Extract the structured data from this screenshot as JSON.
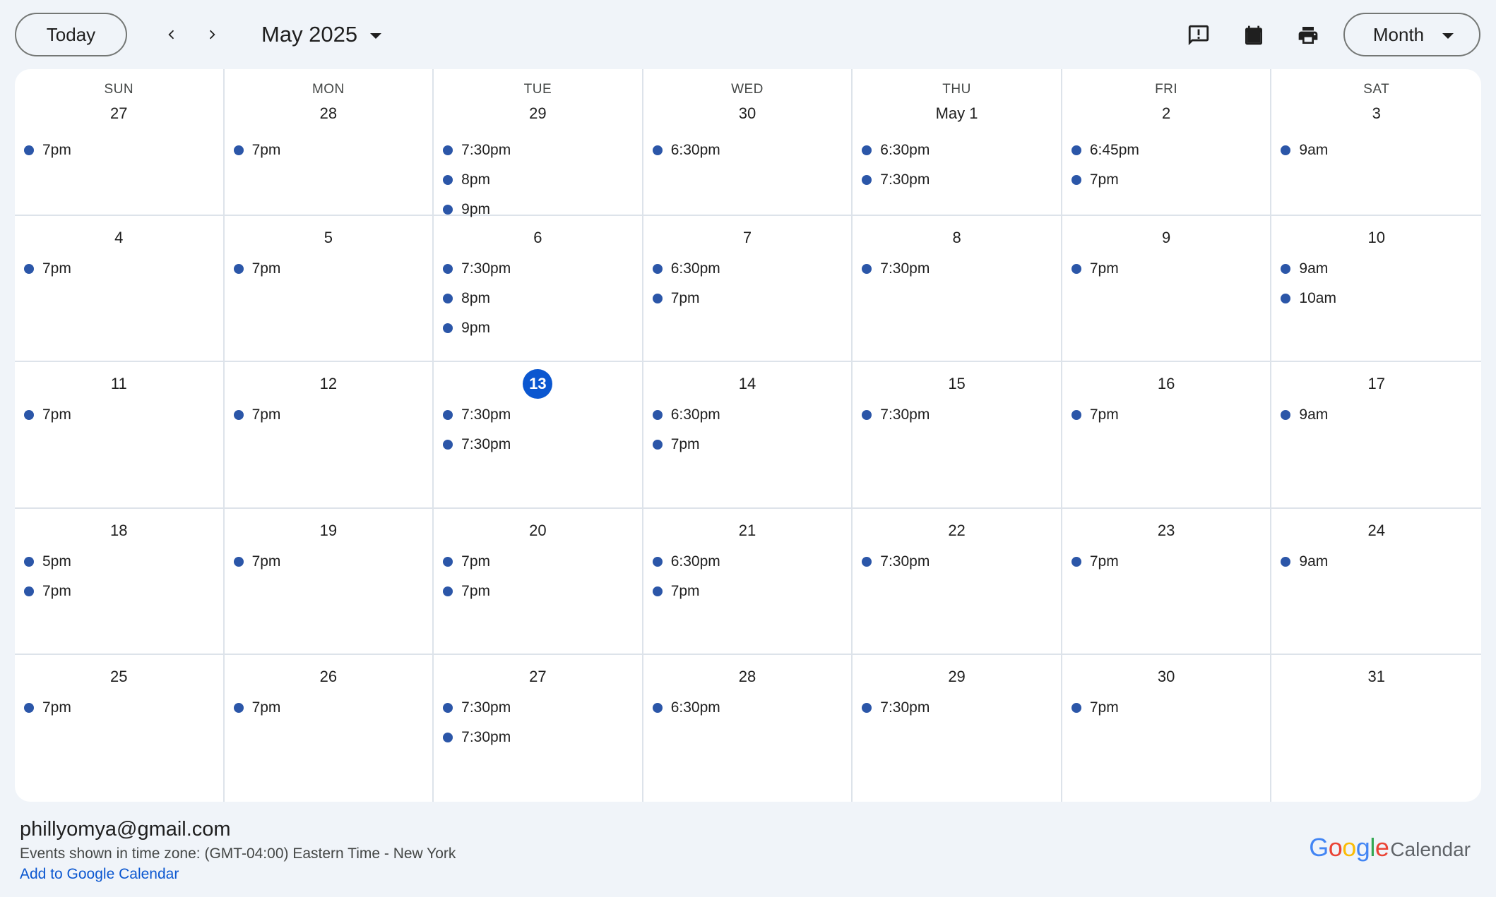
{
  "toolbar": {
    "today_label": "Today",
    "prev_icon": "chevron-left-icon",
    "next_icon": "chevron-right-icon",
    "month_title": "May 2025",
    "feedback_icon": "feedback-icon",
    "calendar_icon": "calendar-icon",
    "print_icon": "print-icon",
    "view_label": "Month"
  },
  "colors": {
    "background": "#f0f4f9",
    "event_dot": "#2b56a8",
    "today_badge": "#0b57d0",
    "link": "#0b57d0"
  },
  "weekdays": [
    "SUN",
    "MON",
    "TUE",
    "WED",
    "THU",
    "FRI",
    "SAT"
  ],
  "today_index": 16,
  "days": [
    {
      "date": "27",
      "events": [
        "7pm"
      ]
    },
    {
      "date": "28",
      "events": [
        "7pm"
      ]
    },
    {
      "date": "29",
      "events": [
        "7:30pm",
        "8pm",
        "9pm"
      ]
    },
    {
      "date": "30",
      "events": [
        "6:30pm"
      ]
    },
    {
      "date": "May 1",
      "events": [
        "6:30pm",
        "7:30pm"
      ]
    },
    {
      "date": "2",
      "events": [
        "6:45pm",
        "7pm"
      ]
    },
    {
      "date": "3",
      "events": [
        "9am"
      ]
    },
    {
      "date": "4",
      "events": [
        "7pm"
      ]
    },
    {
      "date": "5",
      "events": [
        "7pm"
      ]
    },
    {
      "date": "6",
      "events": [
        "7:30pm",
        "8pm",
        "9pm"
      ]
    },
    {
      "date": "7",
      "events": [
        "6:30pm",
        "7pm"
      ]
    },
    {
      "date": "8",
      "events": [
        "7:30pm"
      ]
    },
    {
      "date": "9",
      "events": [
        "7pm"
      ]
    },
    {
      "date": "10",
      "events": [
        "9am",
        "10am"
      ]
    },
    {
      "date": "11",
      "events": [
        "7pm"
      ]
    },
    {
      "date": "12",
      "events": [
        "7pm"
      ]
    },
    {
      "date": "13",
      "events": [
        "7:30pm",
        "7:30pm"
      ]
    },
    {
      "date": "14",
      "events": [
        "6:30pm",
        "7pm"
      ]
    },
    {
      "date": "15",
      "events": [
        "7:30pm"
      ]
    },
    {
      "date": "16",
      "events": [
        "7pm"
      ]
    },
    {
      "date": "17",
      "events": [
        "9am"
      ]
    },
    {
      "date": "18",
      "events": [
        "5pm",
        "7pm"
      ]
    },
    {
      "date": "19",
      "events": [
        "7pm"
      ]
    },
    {
      "date": "20",
      "events": [
        "7pm",
        "7pm"
      ]
    },
    {
      "date": "21",
      "events": [
        "6:30pm",
        "7pm"
      ]
    },
    {
      "date": "22",
      "events": [
        "7:30pm"
      ]
    },
    {
      "date": "23",
      "events": [
        "7pm"
      ]
    },
    {
      "date": "24",
      "events": [
        "9am"
      ]
    },
    {
      "date": "25",
      "events": [
        "7pm"
      ]
    },
    {
      "date": "26",
      "events": [
        "7pm"
      ]
    },
    {
      "date": "27",
      "events": [
        "7:30pm",
        "7:30pm"
      ]
    },
    {
      "date": "28",
      "events": [
        "6:30pm"
      ]
    },
    {
      "date": "29",
      "events": [
        "7:30pm"
      ]
    },
    {
      "date": "30",
      "events": [
        "7pm"
      ]
    },
    {
      "date": "31",
      "events": []
    }
  ],
  "footer": {
    "email": "phillyomya@gmail.com",
    "timezone_text": "Events shown in time zone: (GMT-04:00) Eastern Time - New York",
    "add_link": "Add to Google Calendar",
    "logo_google": "Google",
    "logo_calendar": "Calendar",
    "logo_colors": [
      "#4285f4",
      "#ea4335",
      "#fbbc05",
      "#4285f4",
      "#34a853",
      "#ea4335"
    ]
  }
}
